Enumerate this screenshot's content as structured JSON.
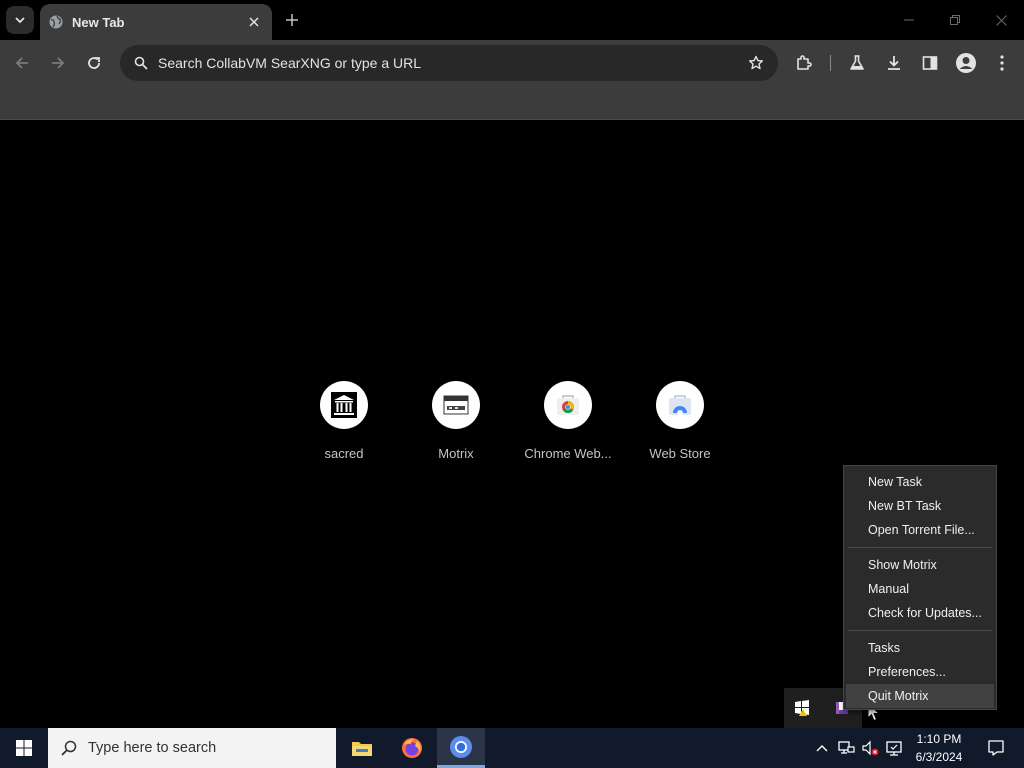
{
  "browser": {
    "tab": {
      "title": "New Tab"
    },
    "omnibox": {
      "placeholder": "Search CollabVM SearXNG or type a URL"
    }
  },
  "new_tab_page": {
    "shortcuts": [
      {
        "label": "sacred",
        "icon": "museum-icon"
      },
      {
        "label": "Motrix",
        "icon": "motrix-icon"
      },
      {
        "label": "Chrome Web...",
        "icon": "chrome-web-store-icon"
      },
      {
        "label": "Web Store",
        "icon": "web-store-icon"
      }
    ]
  },
  "context_menu": {
    "groups": [
      [
        "New Task",
        "New BT Task",
        "Open Torrent File..."
      ],
      [
        "Show Motrix",
        "Manual",
        "Check for Updates..."
      ],
      [
        "Tasks",
        "Preferences...",
        "Quit Motrix"
      ]
    ],
    "hovered_item": "Quit Motrix"
  },
  "taskbar": {
    "search_placeholder": "Type here to search",
    "apps": [
      "file-explorer-icon",
      "firefox-icon",
      "chromium-icon"
    ],
    "clock": {
      "time": "1:10 PM",
      "date": "6/3/2024"
    }
  },
  "colors": {
    "toolbar": "#3c3c3c",
    "tab_strip": "#000000",
    "omnibox": "#282828",
    "menu_bg": "#2b2b2b",
    "taskbar": "#101a2a"
  }
}
